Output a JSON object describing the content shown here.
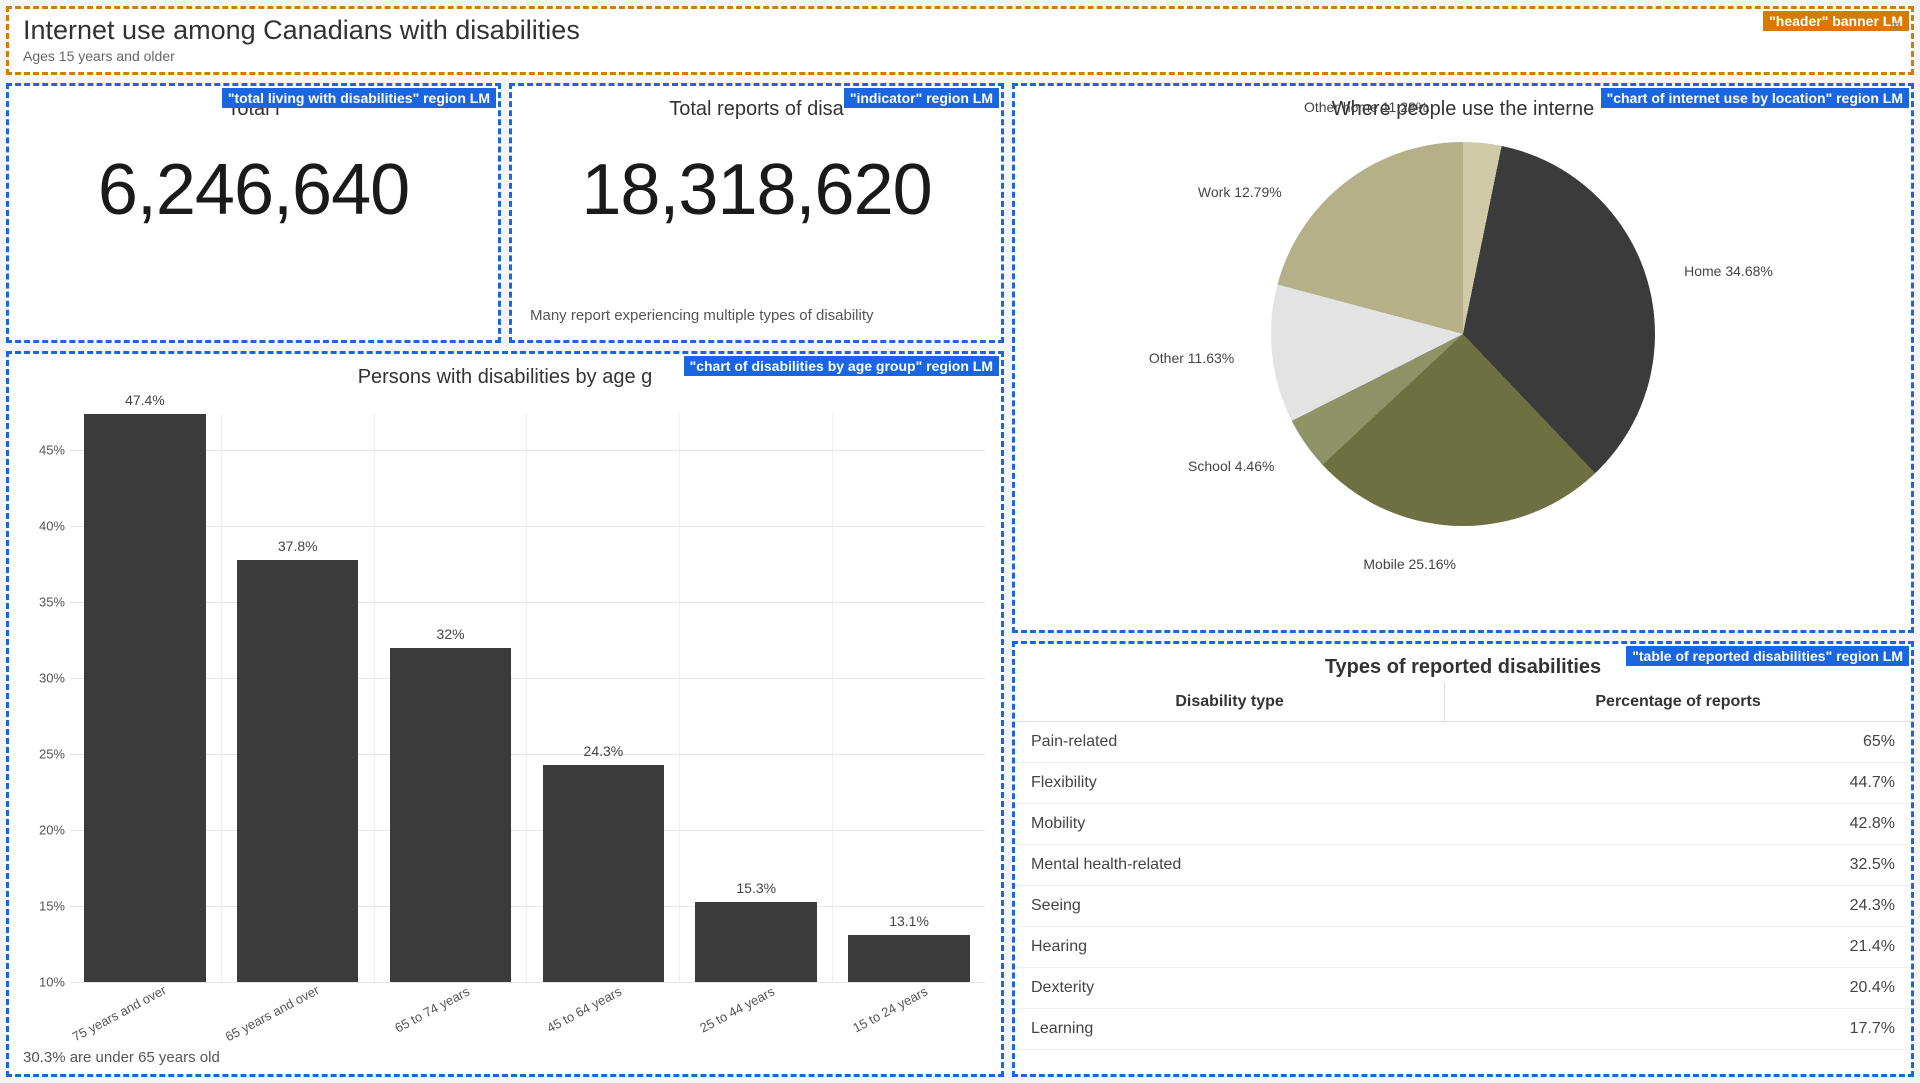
{
  "header": {
    "title": "Internet use among Canadians with disabilities",
    "subtitle": "Ages 15 years and older",
    "badge": "\"header\" banner LM"
  },
  "regions": {
    "total_living": {
      "badge": "\"total living with disabilities\" region LM",
      "title_visible_prefix": "Total l",
      "value": "6,246,640"
    },
    "indicator": {
      "badge": "\"indicator\" region LM",
      "title": "Total reports of disa",
      "value": "18,318,620",
      "note": "Many report experiencing multiple types of disability"
    },
    "bar": {
      "badge": "\"chart of disabilities by age group\" region LM",
      "title": "Persons with disabilities by age g",
      "footnote": "30.3% are under 65 years old"
    },
    "pie": {
      "badge": "\"chart of internet use by location\" region LM",
      "title": "Where people use the interne"
    },
    "table": {
      "badge": "\"table of reported disabilities\" region LM",
      "title": "Types of reported disabilities",
      "col1": "Disability type",
      "col2": "Percentage of reports",
      "rows": [
        {
          "type": "Pain-related",
          "pct": "65%"
        },
        {
          "type": "Flexibility",
          "pct": "44.7%"
        },
        {
          "type": "Mobility",
          "pct": "42.8%"
        },
        {
          "type": "Mental health-related",
          "pct": "32.5%"
        },
        {
          "type": "Seeing",
          "pct": "24.3%"
        },
        {
          "type": "Hearing",
          "pct": "21.4%"
        },
        {
          "type": "Dexterity",
          "pct": "20.4%"
        },
        {
          "type": "Learning",
          "pct": "17.7%"
        }
      ]
    }
  },
  "chart_data": [
    {
      "id": "age_bar",
      "type": "bar",
      "title": "Persons with disabilities by age group",
      "ylabel": "",
      "ylim": [
        10,
        47.4
      ],
      "yticks": [
        10,
        15,
        20,
        25,
        30,
        35,
        40,
        45
      ],
      "categories": [
        "75 years and over",
        "65 years and over",
        "65 to 74 years",
        "45 to 64 years",
        "25 to 44 years",
        "15 to 24 years"
      ],
      "values": [
        47.4,
        37.8,
        32,
        24.3,
        15.3,
        13.1
      ],
      "value_labels": [
        "47.4%",
        "37.8%",
        "32%",
        "24.3%",
        "15.3%",
        "13.1%"
      ]
    },
    {
      "id": "location_pie",
      "type": "pie",
      "title": "Where people use the internet",
      "series": [
        {
          "name": "Other home",
          "value": 11.28,
          "label": "Other home 11.28%",
          "color": "#cfcaa8"
        },
        {
          "name": "Home",
          "value": 34.68,
          "label": "Home 34.68%",
          "color": "#3b3b3b"
        },
        {
          "name": "Mobile",
          "value": 25.16,
          "label": "Mobile 25.16%",
          "color": "#6d7040"
        },
        {
          "name": "School",
          "value": 4.46,
          "label": "School 4.46%",
          "color": "#8f9468"
        },
        {
          "name": "Other",
          "value": 11.63,
          "label": "Other 11.63%",
          "color": "#e3e3e3"
        },
        {
          "name": "Work",
          "value": 12.79,
          "label": "Work 12.79%",
          "color": "#b4b088"
        }
      ]
    }
  ]
}
